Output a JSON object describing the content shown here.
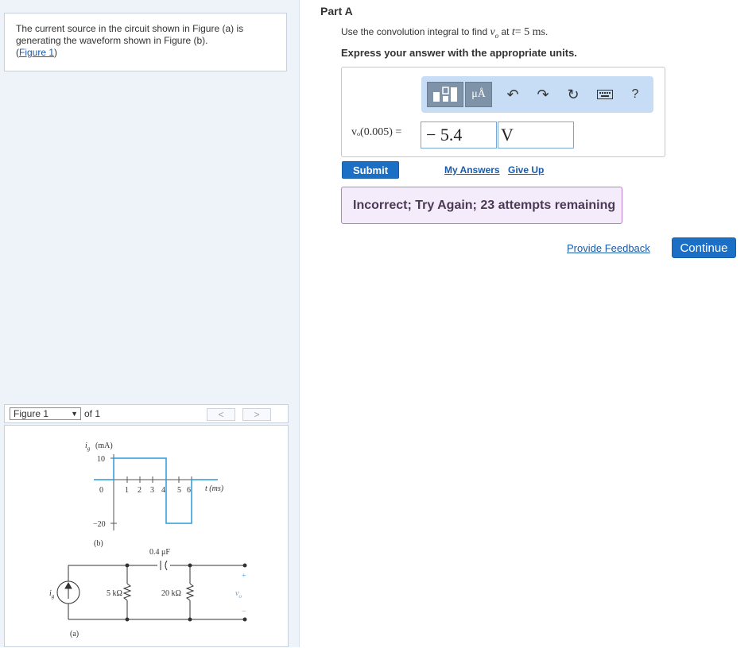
{
  "intro": {
    "text": "The current source in the circuit shown in Figure (a) is generating the waveform shown in Figure (b).",
    "figure_link_open": "(",
    "figure_link": "Figure 1",
    "figure_link_close": ")"
  },
  "figure_nav": {
    "selected": "Figure 1",
    "of_label": "of 1",
    "prev_icon": "<",
    "next_icon": ">"
  },
  "figure": {
    "waveform": {
      "y_axis_label": "i",
      "y_axis_sub": "g",
      "y_axis_unit": "(mA)",
      "y_tick_top": "10",
      "y_tick_zero": "0",
      "y_tick_bottom": "−20",
      "x_ticks": [
        "1",
        "2",
        "3",
        "4",
        "5",
        "6"
      ],
      "x_axis_label": "t (ms)",
      "caption": "(b)"
    },
    "circuit": {
      "capacitor_label": "0.4 μF",
      "resistor1_label": "5 kΩ",
      "resistor2_label": "20 kΩ",
      "source_label": "i",
      "source_sub": "g",
      "plus": "+",
      "minus": "−",
      "output_label": "v",
      "output_sub": "o",
      "caption": "(a)"
    }
  },
  "part": {
    "title": "Part A",
    "instruction_prefix": "Use the convolution integral to find ",
    "instruction_var": "v",
    "instruction_var_sub": "o",
    "instruction_mid": " at ",
    "instruction_t": "t",
    "instruction_value": "= 5 ms",
    "instruction_end": ".",
    "units_note": "Express your answer with the appropriate units."
  },
  "toolbar": {
    "units_label": "μÅ",
    "undo_icon": "↶",
    "redo_icon": "↷",
    "reset_icon": "↻",
    "help_label": "?"
  },
  "answer": {
    "equation_label": "vₒ(0.005) =",
    "value": "− 5.4",
    "unit": "V"
  },
  "actions": {
    "submit": "Submit",
    "my_answers": "My Answers",
    "give_up": "Give Up"
  },
  "feedback": {
    "message": "Incorrect; Try Again; 23 attempts remaining"
  },
  "footer": {
    "provide_feedback": "Provide Feedback",
    "continue": "Continue"
  },
  "colors": {
    "accent": "#1b70c6",
    "link": "#1a5aa8",
    "waveform": "#2a9ad8",
    "feedback_bg": "#f5ecfb",
    "feedback_border": "#b77fd1",
    "panel_bg": "#eef3fa"
  }
}
